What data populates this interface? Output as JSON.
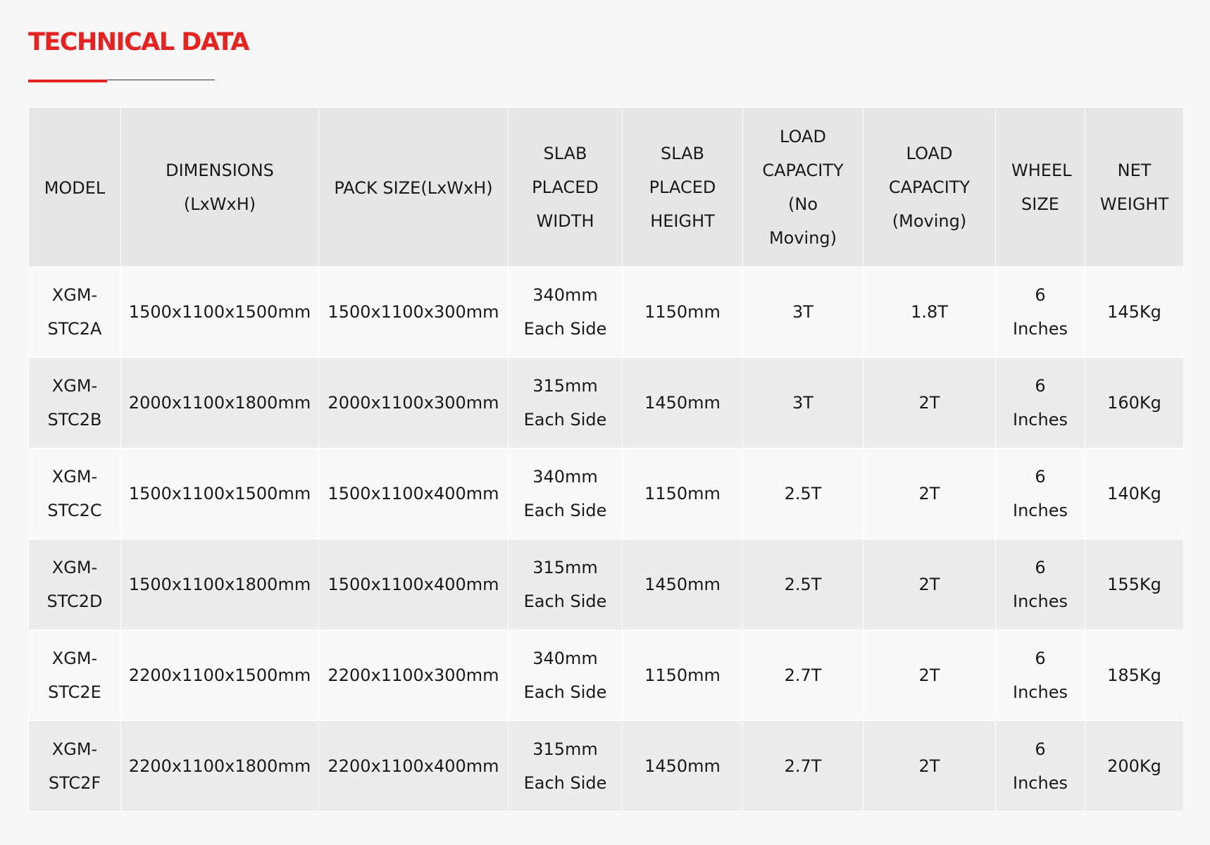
{
  "section_title": "TECHNICAL DATA",
  "colors": {
    "accent": "#e52320",
    "header_bg": "#e6e6e6",
    "row_light": "#f9f9f9",
    "row_dark": "#ececec"
  },
  "table": {
    "headers": [
      "MODEL",
      "DIMENSIONS (LxWxH)",
      "PACK SIZE(LxWxH)",
      "SLAB PLACED WIDTH",
      "SLAB PLACED HEIGHT",
      "LOAD CAPACITY (No Moving)",
      "LOAD CAPACITY (Moving)",
      "WHEEL SIZE",
      "NET WEIGHT"
    ],
    "rows": [
      [
        "XGM-STC2A",
        "1500x1100x1500mm",
        "1500x1100x300mm",
        "340mm Each Side",
        "1150mm",
        "3T",
        "1.8T",
        "6 Inches",
        "145Kg"
      ],
      [
        "XGM-STC2B",
        "2000x1100x1800mm",
        "2000x1100x300mm",
        "315mm Each Side",
        "1450mm",
        "3T",
        "2T",
        "6 Inches",
        "160Kg"
      ],
      [
        "XGM-STC2C",
        "1500x1100x1500mm",
        "1500x1100x400mm",
        "340mm Each Side",
        "1150mm",
        "2.5T",
        "2T",
        "6 Inches",
        "140Kg"
      ],
      [
        "XGM-STC2D",
        "1500x1100x1800mm",
        "1500x1100x400mm",
        "315mm Each Side",
        "1450mm",
        "2.5T",
        "2T",
        "6 Inches",
        "155Kg"
      ],
      [
        "XGM-STC2E",
        "2200x1100x1500mm",
        "2200x1100x300mm",
        "340mm Each Side",
        "1150mm",
        "2.7T",
        "2T",
        "6 Inches",
        "185Kg"
      ],
      [
        "XGM-STC2F",
        "2200x1100x1800mm",
        "2200x1100x400mm",
        "315mm Each Side",
        "1450mm",
        "2.7T",
        "2T",
        "6 Inches",
        "200Kg"
      ]
    ]
  }
}
